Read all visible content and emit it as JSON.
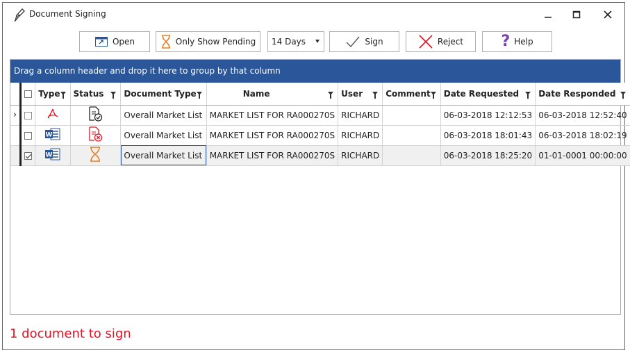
{
  "window": {
    "title": "Document Signing"
  },
  "toolbar": {
    "open_label": "Open",
    "pending_label": "Only Show Pending",
    "days_value": "14 Days",
    "sign_label": "Sign",
    "reject_label": "Reject",
    "help_label": "Help"
  },
  "grid": {
    "group_panel_text": "Drag a column header and drop it here to group by that column",
    "columns": [
      "Type",
      "Status",
      "Document Type",
      "Name",
      "User",
      "Comment",
      "Date Requested",
      "Date Responded"
    ],
    "rows": [
      {
        "checked": false,
        "type_icon": "pdf-icon",
        "status_icon": "document-approved-icon",
        "document_type": "Overall Market List",
        "name": "MARKET LIST FOR RA000270S",
        "user": "RICHARD",
        "comment": "",
        "date_requested": "06-03-2018 12:12:53",
        "date_responded": "06-03-2018 12:52:40",
        "current": true
      },
      {
        "checked": false,
        "type_icon": "word-icon",
        "status_icon": "document-rejected-icon",
        "document_type": "Overall Market List",
        "name": "MARKET LIST FOR RA000270S",
        "user": "RICHARD",
        "comment": "",
        "date_requested": "06-03-2018 18:01:43",
        "date_responded": "06-03-2018 18:02:19",
        "current": false
      },
      {
        "checked": true,
        "type_icon": "word-icon",
        "status_icon": "hourglass-pending-icon",
        "document_type": "Overall Market List",
        "name": "MARKET LIST FOR RA000270S",
        "user": "RICHARD",
        "comment": "",
        "date_requested": "06-03-2018 18:25:20",
        "date_responded": "01-01-0001 00:00:00",
        "current": false
      }
    ]
  },
  "status": {
    "text": "1 document to sign"
  },
  "colors": {
    "accent": "#2b579a",
    "reject": "#e81123",
    "pending": "#e67e22",
    "approved": "#2e7d32"
  }
}
